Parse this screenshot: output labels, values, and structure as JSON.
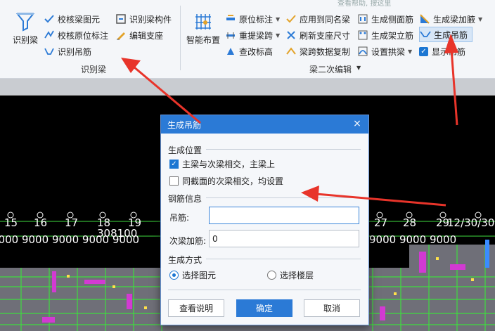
{
  "ribbon": {
    "top_hint": "查看帮助, 搜这里",
    "group1": {
      "label": "识别梁",
      "big": "识别梁",
      "items": [
        "校核梁图元",
        "识别梁构件",
        "校核原位标注",
        "编辑支座",
        "识别吊筋"
      ]
    },
    "group2": {
      "label": "梁二次编辑",
      "big": "智能布置",
      "col1": [
        "原位标注",
        "重提梁跨",
        "查改标高"
      ],
      "col2": [
        "应用到同名梁",
        "刷新支座尺寸",
        "梁跨数据复制"
      ],
      "col3": [
        "生成侧面筋",
        "生成架立筋",
        "设置拱梁"
      ],
      "col4": [
        "生成梁加腋",
        "生成吊筋",
        "显示吊筋"
      ]
    }
  },
  "canvas": {
    "axis_numbers": [
      "15",
      "16",
      "17",
      "18",
      "19",
      "27",
      "28",
      "29",
      "30"
    ],
    "dim_text": "9000",
    "total_text": "308100",
    "right_dim": "12/30/30"
  },
  "dialog": {
    "title": "生成吊筋",
    "close": "×",
    "section_position": "生成位置",
    "opt_main_sec": "主梁与次梁相交，主梁上",
    "opt_same_section": "同截面的次梁相交，均设置",
    "section_rebar": "钢筋信息",
    "hanger_label": "吊筋:",
    "hanger_value": "",
    "sec_beam_label": "次梁加筋:",
    "sec_beam_value": "0",
    "section_method": "生成方式",
    "radio_select_elem": "选择图元",
    "radio_select_floor": "选择楼层",
    "btn_help": "查看说明",
    "btn_ok": "确定",
    "btn_cancel": "取消"
  },
  "colors": {
    "accent": "#2b7ad6",
    "arrow": "#e8342a",
    "cad_green": "#3fdc3f",
    "cad_magenta": "#d23ad2",
    "cad_gray": "#6f6f78"
  }
}
